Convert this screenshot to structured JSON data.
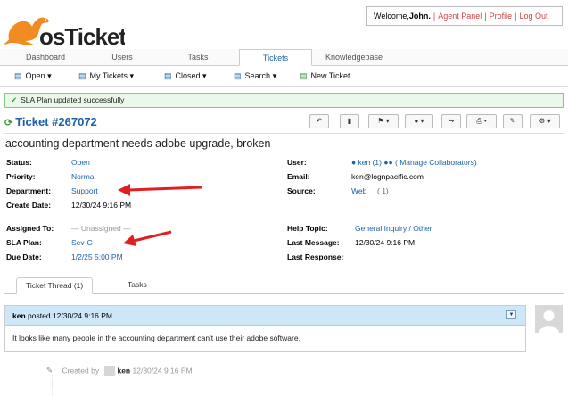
{
  "brand": {
    "logo_text": "osTicket",
    "accent": "#f18b22",
    "link_color": "#1d5fa8"
  },
  "header": {
    "welcome_prefix": "Welcome, ",
    "user_name": "John.",
    "separator": "|",
    "links": [
      "Agent Panel",
      "Profile",
      "Log Out"
    ]
  },
  "nav": {
    "tabs": [
      "Dashboard",
      "Users",
      "Tasks",
      "Tickets",
      "Knowledgebase"
    ],
    "active": "Tickets"
  },
  "subnav": {
    "items": [
      "Open",
      "My Tickets",
      "Closed",
      "Search",
      "New Ticket"
    ]
  },
  "alert": {
    "text": "SLA Plan updated successfully"
  },
  "ticket": {
    "number": "Ticket #267072",
    "subject": "accounting department needs adobe upgrade, broken",
    "left": [
      {
        "label": "Status:",
        "value": "Open"
      },
      {
        "label": "Priority:",
        "value": "Normal"
      },
      {
        "label": "Department:",
        "value": "Support"
      },
      {
        "label": "Create Date:",
        "value": "12/30/24 9:16 PM"
      }
    ],
    "right": [
      {
        "label": "User:",
        "value": "ken (1)",
        "extra": "( Manage Collaborators)"
      },
      {
        "label": "Email:",
        "value": "ken@lognpacific.com"
      },
      {
        "label": "Source:",
        "value": "Web",
        "extra": "( 1)"
      }
    ],
    "left2": [
      {
        "label": "Assigned To:",
        "value": "— Unassigned —"
      },
      {
        "label": "SLA Plan:",
        "value": "Sev-C"
      },
      {
        "label": "Due Date:",
        "value": "1/2/25 5:00 PM"
      }
    ],
    "right2": [
      {
        "label": "Help Topic:",
        "value": "General Inquiry / Other"
      },
      {
        "label": "Last Message:",
        "value": "12/30/24 9:16 PM"
      },
      {
        "label": "Last Response:",
        "value": ""
      }
    ]
  },
  "tabs": {
    "thread": "Ticket Thread (1)",
    "tasks": "Tasks"
  },
  "thread": {
    "author": "ken",
    "posted": "posted 12/30/24 9:16 PM",
    "body": "It looks like many people in the accounting department can't use their adobe software.",
    "created_by_label": "Created by",
    "created_by_user": "ken",
    "created_at": "12/30/24 9:16 PM"
  },
  "icons": [
    "refresh-icon",
    "reply-icon",
    "print-icon",
    "flag-icon",
    "user-icon",
    "share-icon",
    "edit-icon",
    "gear-icon",
    "pencil-icon"
  ]
}
